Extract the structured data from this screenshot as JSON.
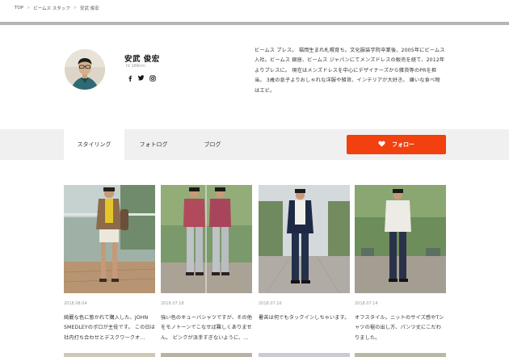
{
  "breadcrumb": {
    "items": [
      "TOP",
      "ビームス スタッフ",
      "安武 俊宏"
    ]
  },
  "profile": {
    "name": "安武 俊宏",
    "height": "ht 166cm",
    "social": [
      "facebook-icon",
      "twitter-icon",
      "instagram-icon"
    ],
    "bio": "ビームス プレス。 福岡生まれ札幌育ち。文化服装学院卒業後、2005年にビームス入社。ビームス 銀座、ビームス ジャパンにてメンズドレスの販売を経て、2012年よりプレスに。 現在はメンズドレスを中心にデザイナーズから雑貨等のPRを担当。 3歳の息子よりおしゃれな洋服や雑貨、インテリアが大好き。 嫌いな食べ物はエビ。"
  },
  "tabs": [
    {
      "label": "スタイリング"
    },
    {
      "label": "フォトログ"
    },
    {
      "label": "ブログ"
    }
  ],
  "follow_label": "フォロー",
  "colors": {
    "accent": "#f2400f",
    "tab_bg": "#f0f0f0",
    "divider": "#b5b5b5"
  },
  "posts": [
    {
      "date": "2018.08.04",
      "desc": "綺麗な色に惹かれて購入した、JOHN SMEDLEYのポロが主役です。 この日は社内打ち合わせとデスクワークオ..."
    },
    {
      "date": "2018.07.18",
      "desc": "強い色のキューバシャツですが、その他をモノトーンでこなせば難しくありません。 ピンクが派手すぎないように、..."
    },
    {
      "date": "2018.07.16",
      "desc": "暑苦は何でもタックインしちゃいます。"
    },
    {
      "date": "2018.07.14",
      "desc": "オフスタイル。ニットのサイズ感やTシャツの裾の出し方、パンツ丈にこだわりました。"
    }
  ]
}
